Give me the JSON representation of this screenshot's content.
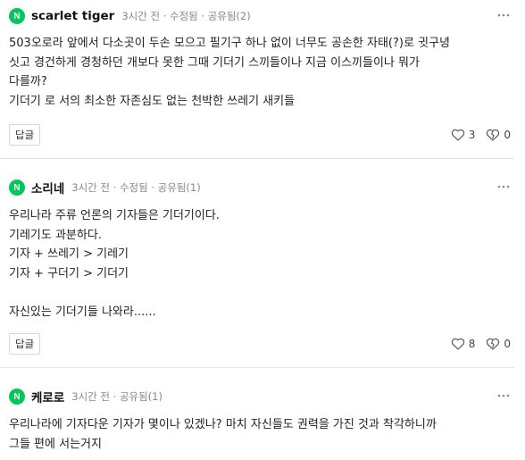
{
  "comments": [
    {
      "avatar_letter": "N",
      "nickname": "scarlet tiger",
      "meta": "3시간 전 · 수정됨 · 공유됨(2)",
      "lines": [
        "503오로라 앞에서 다소곳이 두손 모으고 필기구 하나 없이 너무도 공손한 자태(?)로 귓구녕",
        "싯고 경건하게 경청하던 개보다 못한 그때 기더기 스끼들이나 지금 이스끼들이나 뭐가",
        "다를까?",
        "기더기 로 서의 최소한 자존심도 없는 천박한 쓰레기 새키들"
      ],
      "reply_label": "답글",
      "likes": "3",
      "dislikes": "0"
    },
    {
      "avatar_letter": "N",
      "nickname": "소리네",
      "meta": "3시간 전 · 수정됨 · 공유됨(1)",
      "lines": [
        "우리나라 주류 언론의 기자들은 기더기이다.",
        "기레기도 과분하다.",
        "기자 + 쓰레기 > 기레기",
        "기자 + 구더기 > 기더기",
        "",
        "자신있는 기더기들 나와라......"
      ],
      "reply_label": "답글",
      "likes": "8",
      "dislikes": "0"
    },
    {
      "avatar_letter": "N",
      "nickname": "케로로",
      "meta": "3시간 전 · 공유됨(1)",
      "lines": [
        "우리나라에 기자다운 기자가 몇이나 있겠나? 마치 자신들도 권력을 가진 것과 착각하니까",
        "그들 편에 서는거지"
      ]
    }
  ],
  "icons": {
    "more": "more-options-icon",
    "like": "heart-icon",
    "dislike": "broken-heart-icon"
  },
  "colors": {
    "badge": "#03c75a",
    "divider": "#e5e5e5",
    "meta_text": "#888888"
  }
}
